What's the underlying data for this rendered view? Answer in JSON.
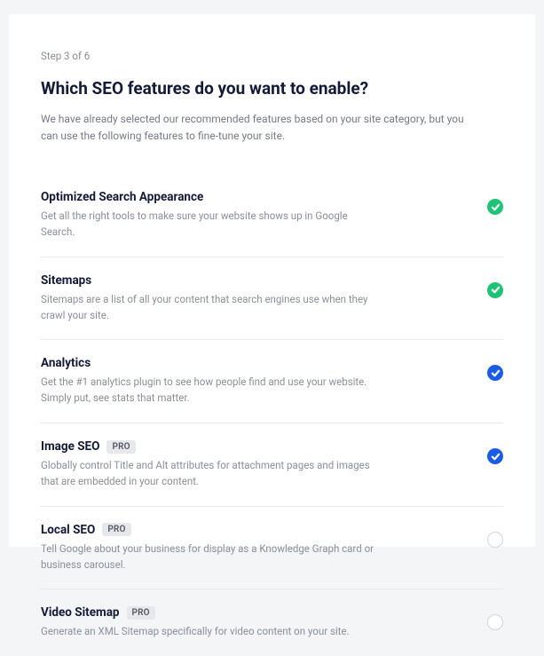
{
  "step_label": "Step 3 of 6",
  "title": "Which SEO features do you want to enable?",
  "subtitle": "We have already selected our recommended features based on your site category, but you can use the following features to fine-tune your site.",
  "pro_label": "PRO",
  "features": [
    {
      "title": "Optimized Search Appearance",
      "desc": "Get all the right tools to make sure your website shows up in Google Search.",
      "pro": false,
      "state": "green"
    },
    {
      "title": "Sitemaps",
      "desc": "Sitemaps are a list of all your content that search engines use when they crawl your site.",
      "pro": false,
      "state": "green"
    },
    {
      "title": "Analytics",
      "desc": "Get the #1 analytics plugin to see how people find and use your website. Simply put, see stats that matter.",
      "pro": false,
      "state": "blue"
    },
    {
      "title": "Image SEO",
      "desc": "Globally control Title and Alt attributes for attachment pages and images that are embedded in your content.",
      "pro": true,
      "state": "blue"
    },
    {
      "title": "Local SEO",
      "desc": "Tell Google about your business for display as a Knowledge Graph card or business carousel.",
      "pro": true,
      "state": "empty"
    },
    {
      "title": "Video Sitemap",
      "desc": "Generate an XML Sitemap specifically for video content on your site.",
      "pro": true,
      "state": "empty"
    }
  ]
}
